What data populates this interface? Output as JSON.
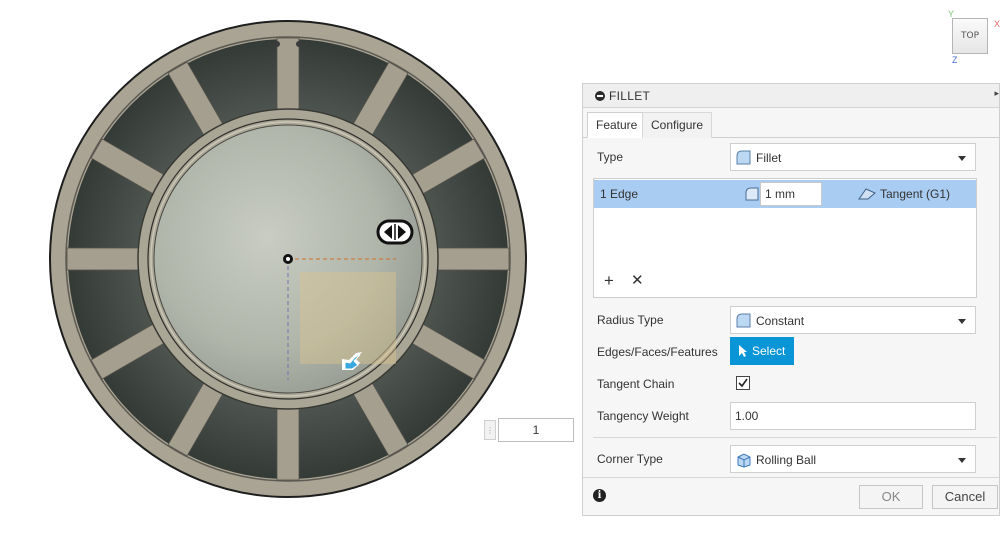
{
  "viewcube": {
    "face_label": "TOP",
    "axis_y": "Y",
    "axis_x": "X",
    "axis_z": "Z"
  },
  "value_box": {
    "value": "1",
    "left_grip": "⋮",
    "right_grip": "⋮"
  },
  "dialog": {
    "title": "FILLET",
    "expand_glyph": "▸",
    "tabs": [
      {
        "label": "Feature"
      },
      {
        "label": "Configure"
      }
    ],
    "type": {
      "label": "Type",
      "value": "Fillet"
    },
    "selection": {
      "edge_label": "1 Edge",
      "radius_value": "1 mm",
      "continuity": "Tangent (G1)",
      "add_glyph": "+",
      "remove_glyph": "✕"
    },
    "radius_type": {
      "label": "Radius Type",
      "value": "Constant"
    },
    "edges_faces": {
      "label": "Edges/Faces/Features",
      "button": "Select"
    },
    "tangent_chain": {
      "label": "Tangent Chain",
      "checked": true
    },
    "tangency_weight": {
      "label": "Tangency Weight",
      "value": "1.00"
    },
    "corner_type": {
      "label": "Corner Type",
      "value": "Rolling Ball"
    },
    "info_glyph": "i",
    "ok_label": "OK",
    "cancel_label": "Cancel"
  },
  "colors": {
    "frame": "#a49f8f",
    "dark_panel": "#3d4440",
    "center_disc": "#b3b8ae",
    "selection_row": "#a9ccf2",
    "select_button": "#0a96d6",
    "manipulator": "#3aa7e0"
  }
}
